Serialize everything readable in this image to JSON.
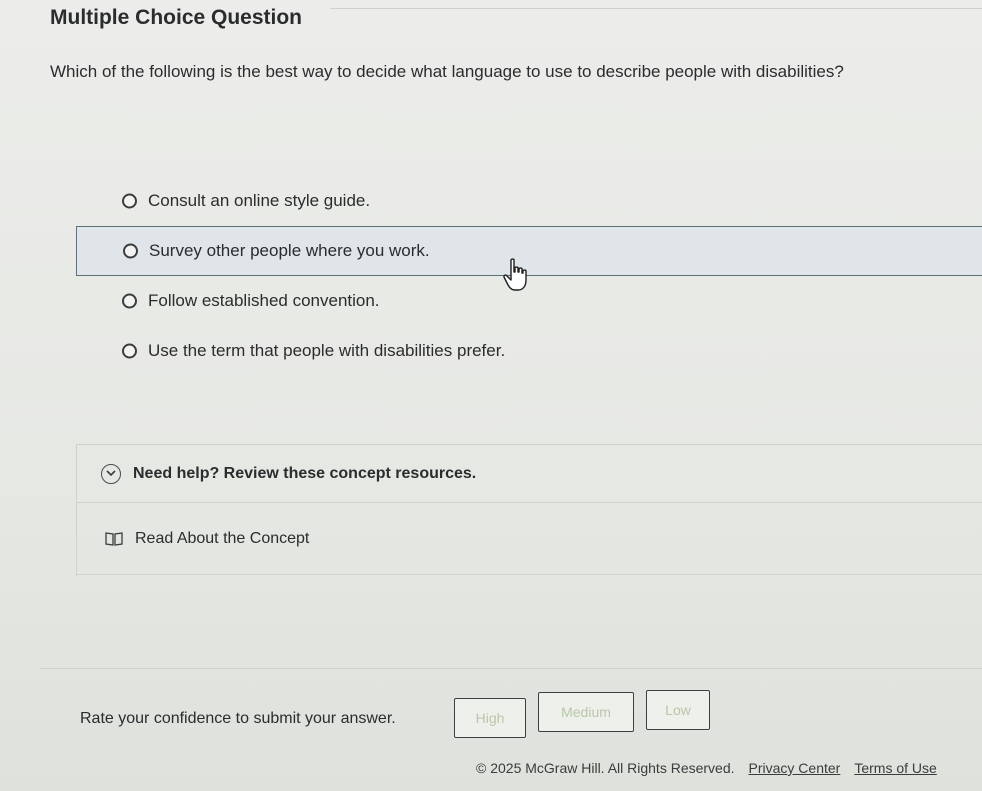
{
  "header": {
    "title": "Multiple Choice Question"
  },
  "question": {
    "text": "Which of the following is the best way to decide what language to use to describe people with disabilities?"
  },
  "options": [
    {
      "label": "Consult an online style guide."
    },
    {
      "label": "Survey other people where you work."
    },
    {
      "label": "Follow established convention."
    },
    {
      "label": "Use the term that people with disabilities prefer."
    }
  ],
  "help": {
    "title": "Need help? Review these concept resources.",
    "concept_label": "Read About the Concept"
  },
  "confidence": {
    "label": "Rate your confidence to submit your answer.",
    "high": "High",
    "medium": "Medium",
    "low": "Low"
  },
  "footer": {
    "copyright": "© 2025 McGraw Hill. All Rights Reserved.",
    "privacy": "Privacy Center",
    "terms": "Terms of Use"
  },
  "colors": {
    "accent_hover": "#dfe5e8",
    "hover_border": "#5f6f7a",
    "disabled_text": "#b9c7a8"
  }
}
